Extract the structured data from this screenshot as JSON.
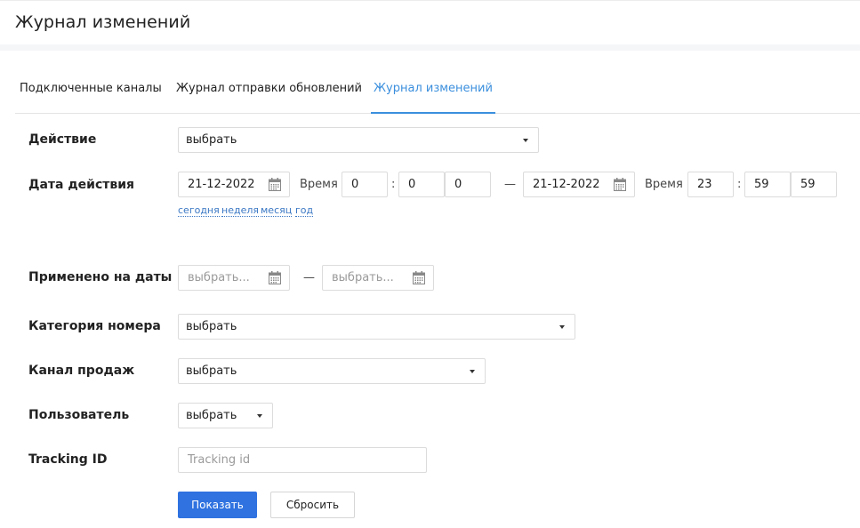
{
  "page": {
    "title": "Журнал изменений"
  },
  "tabs": [
    {
      "label": "Подключенные каналы"
    },
    {
      "label": "Журнал отправки обновлений"
    },
    {
      "label": "Журнал изменений"
    }
  ],
  "form": {
    "action": {
      "label": "Действие",
      "value": "выбрать"
    },
    "action_date": {
      "label": "Дата действия",
      "from_date": "21-12-2022",
      "time_label": "Время",
      "from_hour": "0",
      "from_min": "0",
      "from_sec": "0",
      "dash": "—",
      "to_date": "21-12-2022",
      "to_hour": "23",
      "to_min": "59",
      "to_sec": "59",
      "colon": ":",
      "quick_links": [
        "сегодня",
        "неделя",
        "месяц",
        "год"
      ]
    },
    "applied_dates": {
      "label": "Применено на даты",
      "from_placeholder": "выбрать...",
      "to_placeholder": "выбрать...",
      "dash": "—"
    },
    "room_category": {
      "label": "Категория номера",
      "value": "выбрать"
    },
    "sales_channel": {
      "label": "Канал продаж",
      "value": "выбрать"
    },
    "user": {
      "label": "Пользователь",
      "value": "выбрать"
    },
    "tracking": {
      "label": "Tracking ID",
      "placeholder": "Tracking id"
    }
  },
  "buttons": {
    "show": "Показать",
    "reset": "Сбросить"
  },
  "colors": {
    "accent": "#3b8fdd",
    "primary_button": "#2f72e0",
    "link": "#3b78c4"
  },
  "icons": {
    "calendar": "calendar-icon",
    "dropdown": "chevron-down-icon"
  }
}
